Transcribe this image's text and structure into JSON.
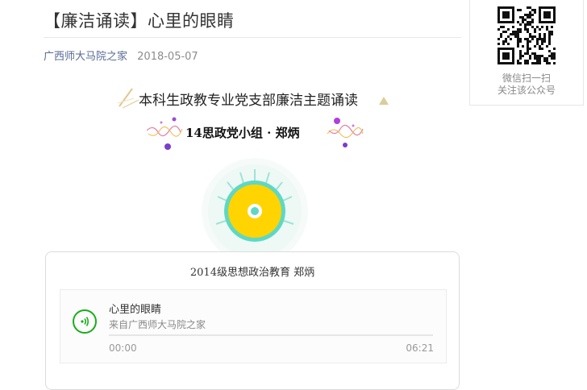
{
  "article": {
    "title": "【廉洁诵读】心里的眼睛",
    "author": "广西师大马院之家",
    "date": "2018-05-07",
    "topic": "本科生政教专业党支部廉洁主题诵读",
    "subtitle": "14思政党小组 · 郑炳"
  },
  "audio": {
    "caption": "2014级思想政治教育 郑炳",
    "track_title": "心里的眼睛",
    "source": "来自广西师大马院之家",
    "current_time": "00:00",
    "duration": "06:21",
    "progress": 0,
    "accent_color": "#1aad19"
  },
  "qr": {
    "line1": "微信扫一扫",
    "line2": "关注该公众号"
  },
  "colors": {
    "link": "#576b95",
    "disc_yellow": "#ffd400",
    "disc_ring": "#5ed8c5"
  },
  "icons": {
    "play": "audio-wave-icon",
    "qr": "qr-code-icon"
  }
}
